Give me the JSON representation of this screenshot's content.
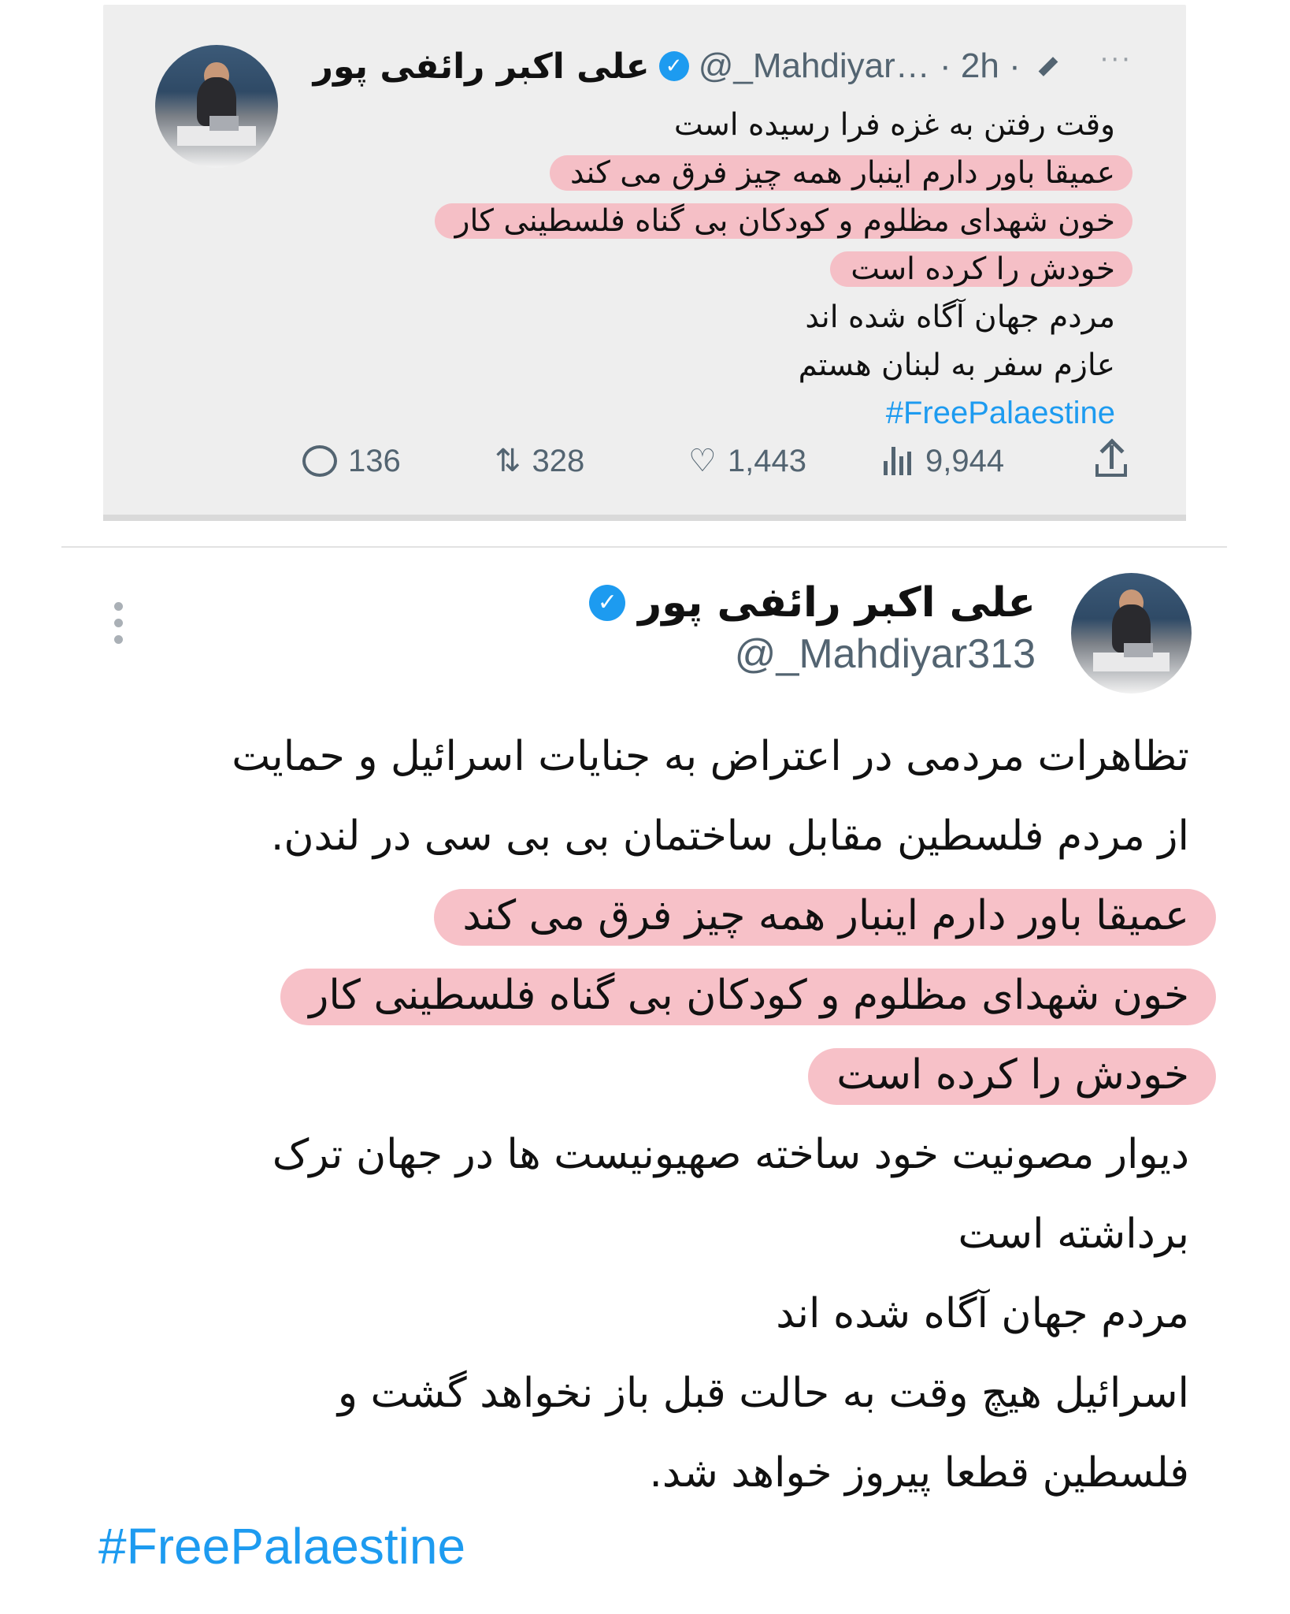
{
  "top_tweet": {
    "author_name": "علی اکبر رائفی پور",
    "handle": "@_Mahdiyar…",
    "separator": "·",
    "time": "2h",
    "more_label": "···",
    "lines": [
      {
        "text": "وقت رفتن به غزه فرا رسیده است",
        "highlighted": false
      },
      {
        "text": "عمیقا باور دارم اینبار همه چیز فرق می کند",
        "highlighted": true
      },
      {
        "text": "خون شهدای مظلوم و کودکان بی گناه فلسطینی کار",
        "highlighted": true
      },
      {
        "text": "خودش را کرده است",
        "highlighted": true
      },
      {
        "text": "مردم جهان آگاه شده اند",
        "highlighted": false
      },
      {
        "text": "عازم سفر به لبنان هستم",
        "highlighted": false
      }
    ],
    "hashtag": "#FreePalaestine",
    "stats": {
      "replies": "136",
      "retweets": "328",
      "likes": "1,443",
      "views": "9,944"
    }
  },
  "bottom_tweet": {
    "author_name": "علی اکبر رائفی پور",
    "handle": "@_Mahdiyar313",
    "lines": [
      {
        "text": "تظاهرات مردمی در اعتراض به جنایات اسرائیل و حمایت",
        "highlighted": false
      },
      {
        "text": "از مردم فلسطین مقابل ساختمان بی بی سی در لندن.",
        "highlighted": false
      },
      {
        "text": "عمیقا باور دارم اینبار همه چیز فرق می کند",
        "highlighted": true
      },
      {
        "text": "خون شهدای مظلوم و کودکان بی گناه فلسطینی کار",
        "highlighted": true
      },
      {
        "text": "خودش را کرده است",
        "highlighted": true
      },
      {
        "text": "دیوار مصونیت خود ساخته صهیونیست ها در جهان ترک",
        "highlighted": false
      },
      {
        "text": "برداشته است",
        "highlighted": false
      },
      {
        "text": "مردم جهان آگاه شده اند",
        "highlighted": false
      },
      {
        "text": "اسرائیل هیچ وقت به حالت قبل باز نخواهد گشت و",
        "highlighted": false
      },
      {
        "text": "فلسطین قطعا پیروز خواهد شد.",
        "highlighted": false
      }
    ],
    "hashtag": "#FreePalaestine"
  },
  "colors": {
    "accent": "#1d9bf0",
    "highlight": "#f6b6be",
    "muted": "#536471",
    "card_background": "#eeeeee"
  },
  "icons": {
    "verified": "verified-badge-icon",
    "edit": "edit-pencil-icon",
    "reply": "reply-bubble-icon",
    "retweet": "retweet-icon",
    "like": "heart-icon",
    "views": "bar-chart-icon",
    "share": "share-icon",
    "more": "more-dots-icon"
  }
}
